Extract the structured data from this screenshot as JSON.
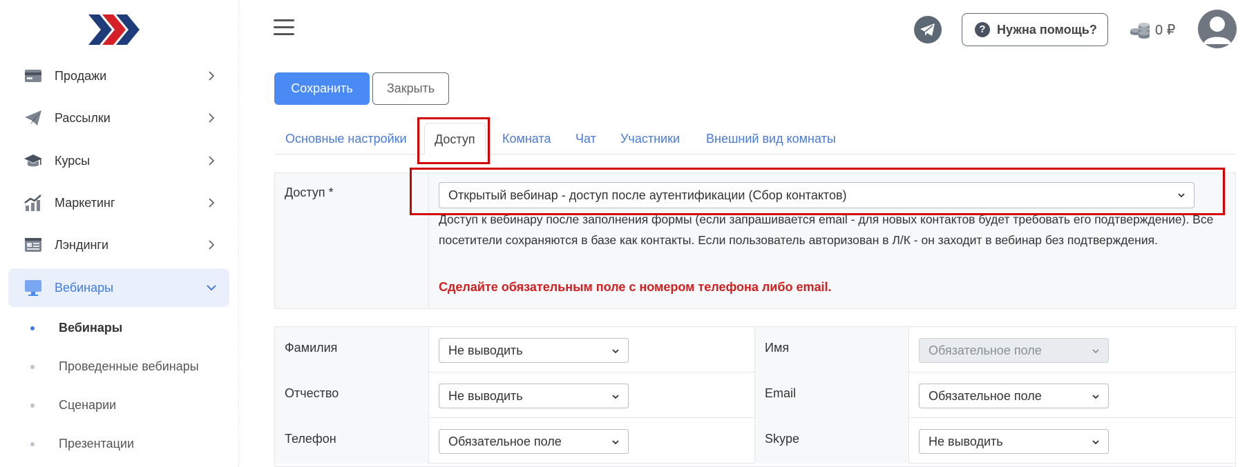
{
  "sidebar": {
    "items": [
      {
        "label": "Продажи",
        "icon": "card-icon"
      },
      {
        "label": "Рассылки",
        "icon": "paper-plane-icon"
      },
      {
        "label": "Курсы",
        "icon": "graduation-cap-icon"
      },
      {
        "label": "Маркетинг",
        "icon": "chart-icon"
      },
      {
        "label": "Лэндинги",
        "icon": "landing-page-icon"
      },
      {
        "label": "Вебинары",
        "icon": "monitor-icon",
        "active": true
      }
    ],
    "subitems": [
      {
        "label": "Вебинары",
        "active": true
      },
      {
        "label": "Проведенные вебинары"
      },
      {
        "label": "Сценарии"
      },
      {
        "label": "Презентации"
      }
    ]
  },
  "header": {
    "help_label": "Нужна помощь?",
    "balance": "0 ₽"
  },
  "toolbar": {
    "save_label": "Сохранить",
    "close_label": "Закрыть"
  },
  "tabs": [
    {
      "label": "Основные настройки"
    },
    {
      "label": "Доступ",
      "active": true
    },
    {
      "label": "Комната"
    },
    {
      "label": "Чат"
    },
    {
      "label": "Участники"
    },
    {
      "label": "Внешний вид комнаты"
    }
  ],
  "access": {
    "label": "Доступ *",
    "selected": "Открытый вебинар - доступ после аутентификации (Сбор контактов)",
    "description": "Доступ к вебинару после заполнения формы (если запрашивается email - для новых контактов будет требовать его подтверждение). Все посетители сохраняются в базе как контакты. Если пользователь авторизован в Л/К - он заходит в вебинар без подтверждения.",
    "warning": "Сделайте обязательным поле с номером телефона либо email."
  },
  "fields": [
    {
      "left_label": "Фамилия",
      "left_value": "Не выводить",
      "right_label": "Имя",
      "right_value": "Обязательное поле",
      "right_disabled": true
    },
    {
      "left_label": "Отчество",
      "left_value": "Не выводить",
      "right_label": "Email",
      "right_value": "Обязательное поле"
    },
    {
      "left_label": "Телефон",
      "left_value": "Обязательное поле",
      "right_label": "Skype",
      "right_value": "Не выводить"
    }
  ],
  "colors": {
    "accent": "#4a8af4",
    "highlight_box": "#d40000",
    "warning_text": "#d21f1f"
  }
}
